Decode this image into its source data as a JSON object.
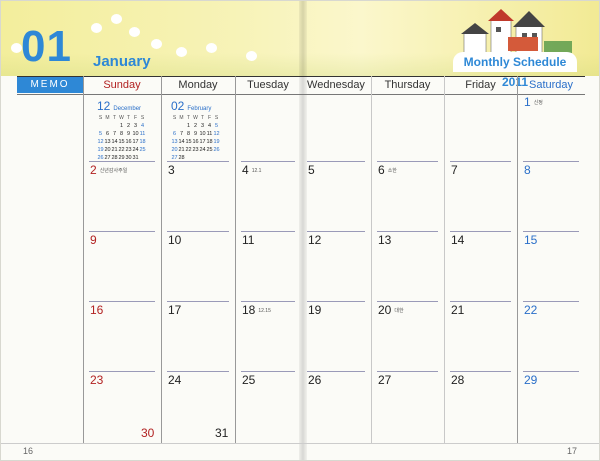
{
  "header": {
    "month_number": "01",
    "month_name": "January",
    "schedule_title": "Monthly Schedule 2011"
  },
  "memo_label": "MEMO",
  "weekdays": [
    "Sunday",
    "Monday",
    "Tuesday",
    "Wednesday",
    "Thursday",
    "Friday",
    "Saturday"
  ],
  "mini_calendars": [
    {
      "month_num": "12",
      "month_name": "December",
      "dow": [
        "S",
        "M",
        "T",
        "W",
        "T",
        "F",
        "S"
      ],
      "rows": [
        [
          "",
          "",
          "",
          "1",
          "2",
          "3",
          "4"
        ],
        [
          "5",
          "6",
          "7",
          "8",
          "9",
          "10",
          "11"
        ],
        [
          "12",
          "13",
          "14",
          "15",
          "16",
          "17",
          "18"
        ],
        [
          "19",
          "20",
          "21",
          "22",
          "23",
          "24",
          "25"
        ],
        [
          "26",
          "27",
          "28",
          "29",
          "30",
          "31",
          ""
        ]
      ]
    },
    {
      "month_num": "02",
      "month_name": "February",
      "dow": [
        "S",
        "M",
        "T",
        "W",
        "T",
        "F",
        "S"
      ],
      "rows": [
        [
          "",
          "",
          "1",
          "2",
          "3",
          "4",
          "5"
        ],
        [
          "6",
          "7",
          "8",
          "9",
          "10",
          "11",
          "12"
        ],
        [
          "13",
          "14",
          "15",
          "16",
          "17",
          "18",
          "19"
        ],
        [
          "20",
          "21",
          "22",
          "23",
          "24",
          "25",
          "26"
        ],
        [
          "27",
          "28",
          "",
          "",
          "",
          "",
          ""
        ]
      ]
    }
  ],
  "days": [
    {
      "d": "1",
      "note": "신정"
    },
    {
      "d": "2",
      "note": "신년감사주일"
    },
    {
      "d": "3",
      "note": ""
    },
    {
      "d": "4",
      "note": "12.1"
    },
    {
      "d": "5",
      "note": ""
    },
    {
      "d": "6",
      "note": "소한"
    },
    {
      "d": "7",
      "note": ""
    },
    {
      "d": "8",
      "note": ""
    },
    {
      "d": "9",
      "note": ""
    },
    {
      "d": "10",
      "note": ""
    },
    {
      "d": "11",
      "note": ""
    },
    {
      "d": "12",
      "note": ""
    },
    {
      "d": "13",
      "note": ""
    },
    {
      "d": "14",
      "note": ""
    },
    {
      "d": "15",
      "note": ""
    },
    {
      "d": "16",
      "note": ""
    },
    {
      "d": "17",
      "note": ""
    },
    {
      "d": "18",
      "note": "12.15"
    },
    {
      "d": "19",
      "note": ""
    },
    {
      "d": "20",
      "note": "대한"
    },
    {
      "d": "21",
      "note": ""
    },
    {
      "d": "22",
      "note": ""
    },
    {
      "d": "23",
      "note": ""
    },
    {
      "d": "24",
      "note": ""
    },
    {
      "d": "25",
      "note": ""
    },
    {
      "d": "26",
      "note": ""
    },
    {
      "d": "27",
      "note": ""
    },
    {
      "d": "28",
      "note": ""
    },
    {
      "d": "29",
      "note": ""
    },
    {
      "d": "30",
      "note": ""
    },
    {
      "d": "31",
      "note": ""
    }
  ],
  "page_numbers": {
    "left": "16",
    "right": "17"
  },
  "colors": {
    "accent": "#2e88d6",
    "sunday": "#b22222",
    "saturday": "#2a6fc9"
  }
}
